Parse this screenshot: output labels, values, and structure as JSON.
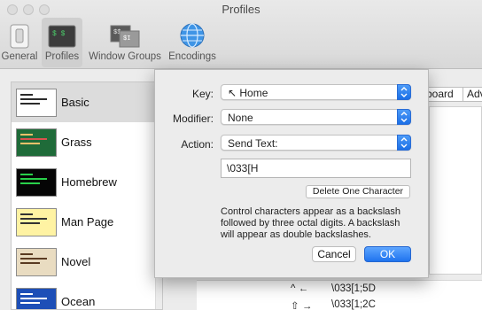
{
  "window": {
    "title": "Profiles"
  },
  "toolbar": {
    "items": [
      {
        "label": "General",
        "icon": "general-switch-icon"
      },
      {
        "label": "Profiles",
        "icon": "terminal-profiles-icon",
        "active": true
      },
      {
        "label": "Window Groups",
        "icon": "window-groups-icon"
      },
      {
        "label": "Encodings",
        "icon": "globe-icon"
      }
    ]
  },
  "profiles": [
    {
      "name": "Basic",
      "bg": "#ffffff",
      "fg": "#2b2b2b",
      "selected": true
    },
    {
      "name": "Grass",
      "bg": "#1f6b39",
      "fg": "#f5c16a"
    },
    {
      "name": "Homebrew",
      "bg": "#050505",
      "fg": "#29d14a"
    },
    {
      "name": "Man Page",
      "bg": "#fff3a3",
      "fg": "#333333"
    },
    {
      "name": "Novel",
      "bg": "#e9dcc1",
      "fg": "#5a3b22"
    },
    {
      "name": "Ocean",
      "bg": "#1d4fb7",
      "fg": "#ffffff"
    }
  ],
  "behind": {
    "tab_keyboard": "board",
    "tab_advanced": "Adv",
    "rows": [
      {
        "keys": "^ ←",
        "action": "\\033[1;5D"
      },
      {
        "keys": "⇧ →",
        "action": "\\033[1;2C"
      }
    ]
  },
  "dialog": {
    "key_label": "Key:",
    "key_value": "↖ Home",
    "modifier_label": "Modifier:",
    "modifier_value": "None",
    "action_label": "Action:",
    "action_value": "Send Text:",
    "text_value": "\\033[H",
    "delete_button": "Delete One Character",
    "note": "Control characters appear as a backslash followed by three octal digits. A backslash will appear as double backslashes.",
    "cancel_button": "Cancel",
    "ok_button": "OK"
  },
  "colors": {
    "accent": "#1f73ee"
  }
}
